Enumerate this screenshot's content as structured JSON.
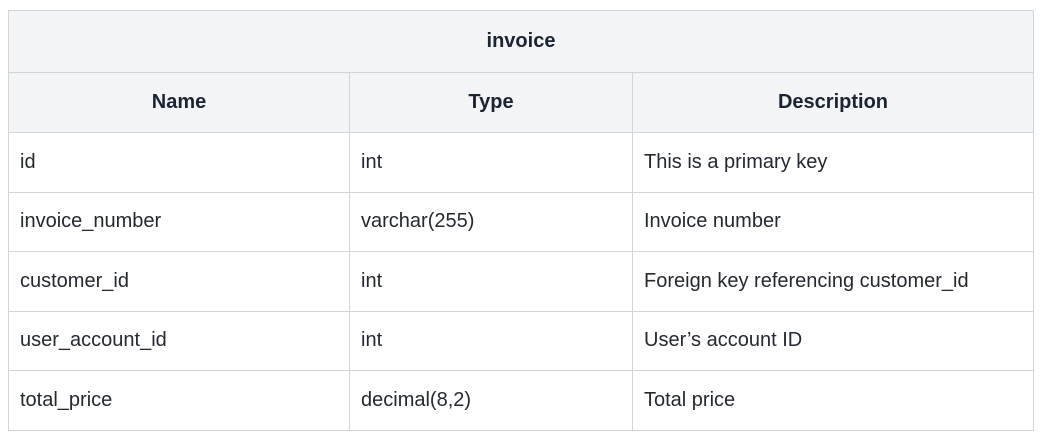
{
  "table": {
    "title": "invoice",
    "headers": [
      "Name",
      "Type",
      "Description"
    ],
    "rows": [
      [
        "id",
        "int",
        "This is a primary key"
      ],
      [
        "invoice_number",
        "varchar(255)",
        "Invoice number"
      ],
      [
        "customer_id",
        "int",
        "Foreign key referencing customer_id"
      ],
      [
        "user_account_id",
        "int",
        "User’s account ID"
      ],
      [
        "total_price",
        "decimal(8,2)",
        "Total price"
      ]
    ]
  },
  "colors": {
    "header_bg": "#f3f4f6",
    "border": "#d0d4db",
    "header_text": "#1a2433",
    "body_text": "#24292f"
  }
}
